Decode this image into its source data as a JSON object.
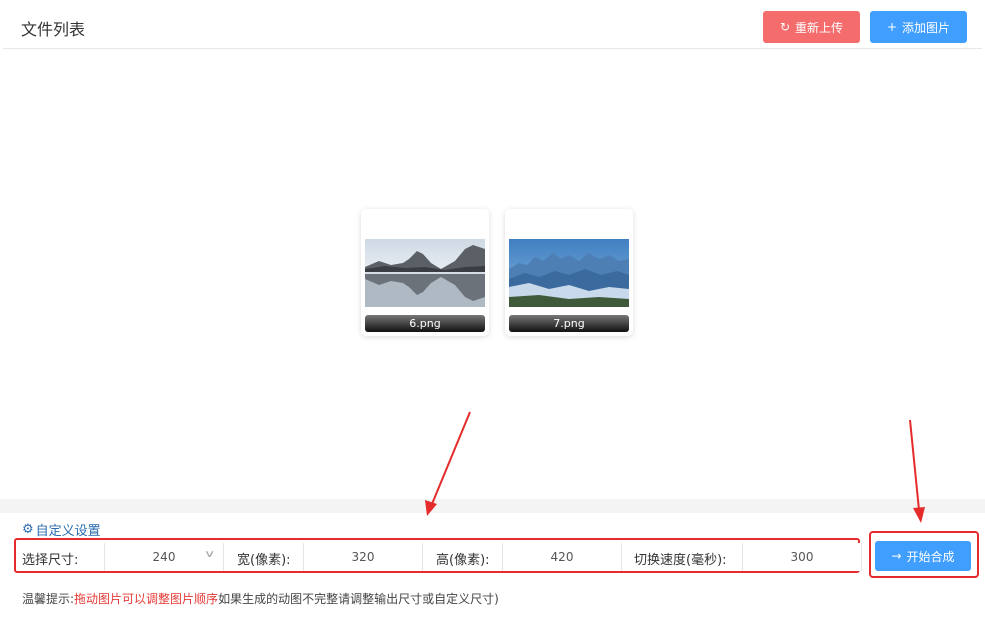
{
  "header": {
    "title": "文件列表",
    "reupload_label": "重新上传",
    "add_label": "添加图片"
  },
  "files": [
    {
      "name": "6.png"
    },
    {
      "name": "7.png"
    }
  ],
  "settings": {
    "custom_link": "自定义设置",
    "size_label": "选择尺寸:",
    "size_value": "240",
    "width_label": "宽(像素):",
    "width_value": "320",
    "height_label": "高(像素):",
    "height_value": "420",
    "speed_label": "切换速度(毫秒):",
    "speed_value": "300"
  },
  "start_label": "开始合成",
  "tip": {
    "prefix": "温馨提示:",
    "highlight": "拖动图片可以调整图片顺序",
    "suffix": "如果生成的动图不完整请调整输出尺寸或自定义尺寸)"
  },
  "colors": {
    "danger": "#f56c6c",
    "primary": "#409eff",
    "annotation": "#e52b2b"
  }
}
